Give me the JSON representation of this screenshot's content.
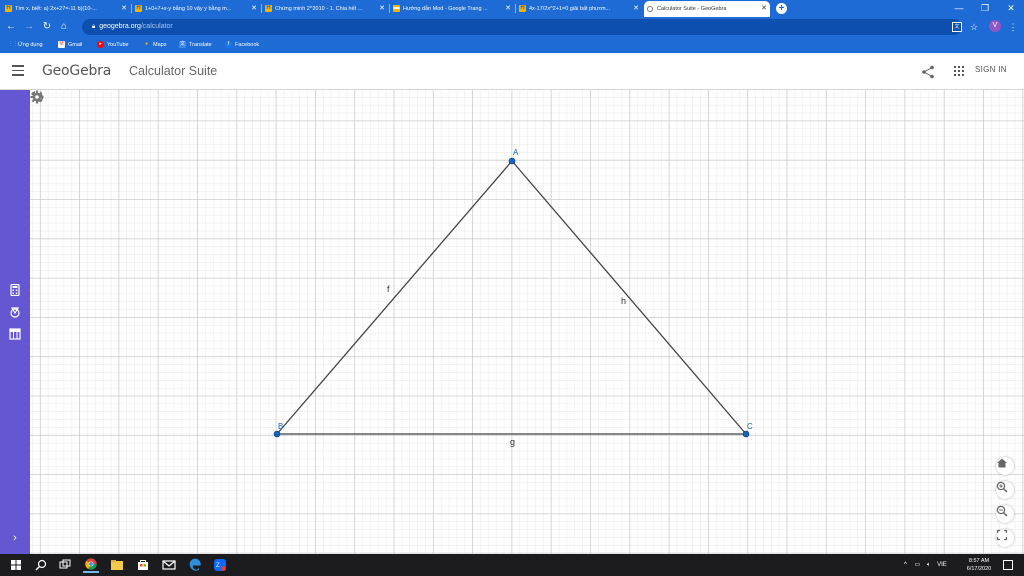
{
  "browser": {
    "tabs": [
      {
        "title": "Tìm x, biết: a) 2x+27=-11 b)(10-...",
        "icon": "homework-h-icon",
        "active": false
      },
      {
        "title": "1+0+7+x-y bằng 10 vậy y bằng m...",
        "icon": "homework-h-icon",
        "active": false
      },
      {
        "title": "Chứng minh 2^2010 - 1. Chia hết ...",
        "icon": "homework-h-icon",
        "active": false
      },
      {
        "title": "Hướng dẫn Mod - Google Trang ...",
        "icon": "google-sites-icon",
        "active": false
      },
      {
        "title": "4x-17/2x^2+1=0 giải bất phươn...",
        "icon": "homework-h-icon",
        "active": false
      },
      {
        "title": "Calculator Suite - GeoGebra",
        "icon": "geogebra-icon",
        "active": true
      }
    ],
    "new_tab": "+",
    "window_controls": {
      "minimize": "—",
      "restore": "❐",
      "close": "✕"
    },
    "url_host": "geogebra.org",
    "url_path": "/calculator",
    "profile_initial": "V",
    "bookmarks": [
      {
        "label": "Ứng dụng",
        "icon": "apps-grid-icon",
        "color": "#7fb3ff"
      },
      {
        "label": "Gmail",
        "icon": "gmail-icon",
        "color": "#ea4335"
      },
      {
        "label": "YouTube",
        "icon": "youtube-icon",
        "color": "#ff0000"
      },
      {
        "label": "Maps",
        "icon": "maps-pin-icon",
        "color": "#34a853"
      },
      {
        "label": "Translate",
        "icon": "translate-icon",
        "color": "#4285f4"
      },
      {
        "label": "Facebook",
        "icon": "facebook-icon",
        "color": "#1877f2"
      }
    ]
  },
  "app": {
    "logo": "GeoGebra",
    "title": "Calculator Suite",
    "sign_in": "SIGN IN"
  },
  "construction": {
    "points": [
      {
        "label": "A"
      },
      {
        "label": "B"
      },
      {
        "label": "C"
      }
    ],
    "segments": [
      {
        "label": "f",
        "from": "B",
        "to": "A"
      },
      {
        "label": "h",
        "from": "A",
        "to": "C"
      },
      {
        "label": "g",
        "from": "B",
        "to": "C"
      }
    ],
    "point_color": "#1565c0",
    "segment_color": "#444444"
  },
  "taskbar": {
    "language": "VIE",
    "time": "8:57 AM",
    "date": "6/17/2020"
  },
  "colors": {
    "chrome_blue": "#1e6bd6",
    "geogebra_purple": "#6557d2",
    "taskbar": "#1c1c1e"
  }
}
